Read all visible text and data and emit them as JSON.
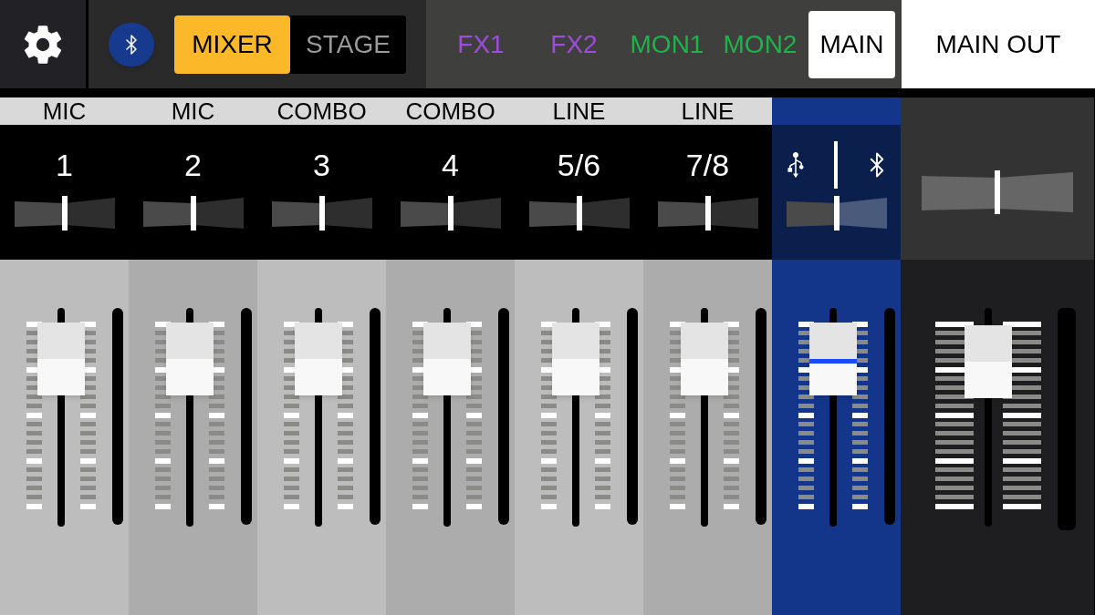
{
  "top_bar": {
    "view_modes": [
      {
        "label": "MIXER",
        "selected": true
      },
      {
        "label": "STAGE",
        "selected": false
      }
    ],
    "buses": [
      {
        "label": "FX1",
        "color": "#a04be0",
        "selected": false
      },
      {
        "label": "FX2",
        "color": "#a04be0",
        "selected": false
      },
      {
        "label": "MON1",
        "color": "#1bb54a",
        "selected": false
      },
      {
        "label": "MON2",
        "color": "#1bb54a",
        "selected": false
      },
      {
        "label": "MAIN",
        "color": "#000000",
        "selected": true
      }
    ],
    "output_title": "MAIN OUT"
  },
  "channels": [
    {
      "kind": "input",
      "type": "MIC",
      "number": "1",
      "pan": {
        "level": 0.5
      }
    },
    {
      "kind": "input",
      "type": "MIC",
      "number": "2",
      "pan": {
        "level": 0.5
      }
    },
    {
      "kind": "input",
      "type": "COMBO",
      "number": "3",
      "pan": {
        "level": 0.5
      }
    },
    {
      "kind": "input",
      "type": "COMBO",
      "number": "4",
      "pan": {
        "level": 0.5
      }
    },
    {
      "kind": "input",
      "type": "LINE",
      "number": "5/6",
      "pan": {
        "level": 0.5
      }
    },
    {
      "kind": "input",
      "type": "LINE",
      "number": "7/8",
      "pan": {
        "level": 0.5
      }
    },
    {
      "kind": "usb_bluetooth",
      "pan": {
        "level": 0.5
      }
    },
    {
      "kind": "main",
      "pan": {
        "level": 0.5
      }
    }
  ]
}
